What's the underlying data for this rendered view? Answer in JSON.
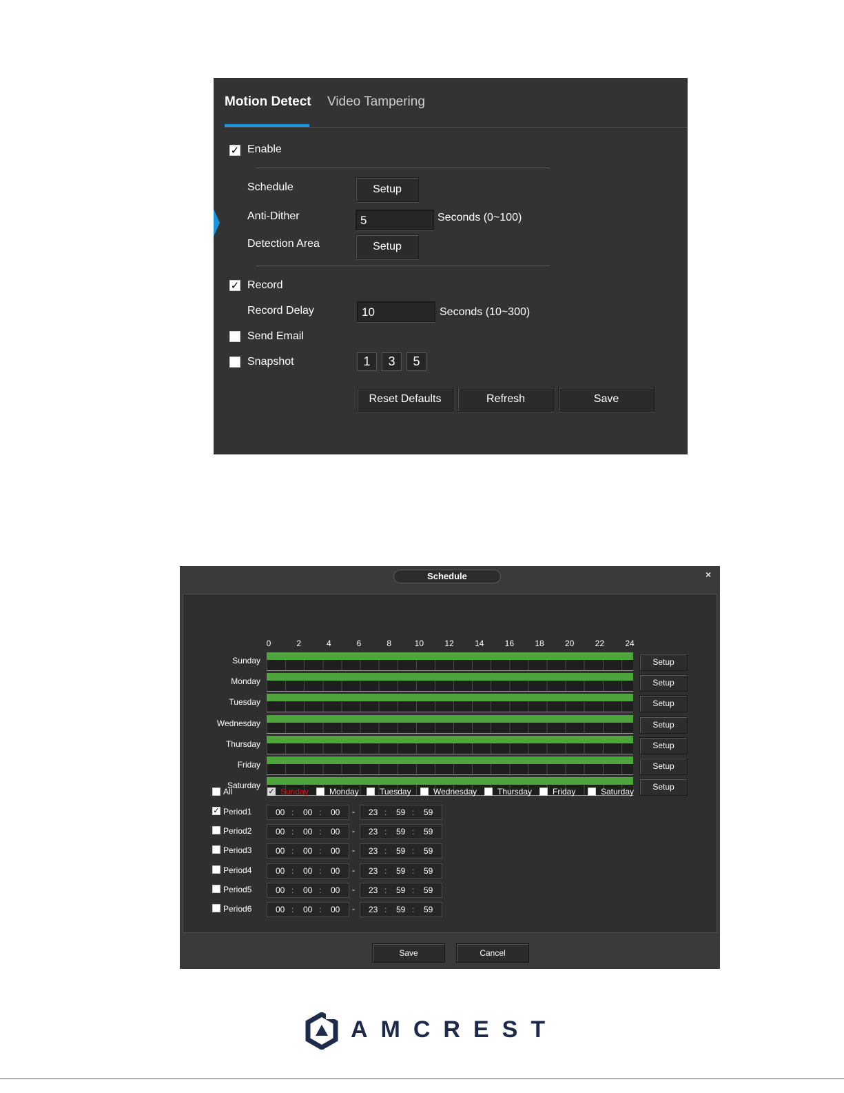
{
  "motion_panel": {
    "tabs": [
      "Motion Detect",
      "Video Tampering"
    ],
    "enable": {
      "label": "Enable",
      "checked": true
    },
    "schedule": {
      "label": "Schedule",
      "button": "Setup"
    },
    "anti_dither": {
      "label": "Anti-Dither",
      "value": "5",
      "unit": "Seconds (0~100)"
    },
    "detection_area": {
      "label": "Detection Area",
      "button": "Setup"
    },
    "record": {
      "label": "Record",
      "checked": true
    },
    "record_delay": {
      "label": "Record Delay",
      "value": "10",
      "unit": "Seconds (10~300)"
    },
    "send_email": {
      "label": "Send Email",
      "checked": false
    },
    "snapshot": {
      "label": "Snapshot",
      "checked": false,
      "channels": [
        "1",
        "3",
        "5"
      ]
    },
    "buttons": {
      "reset": "Reset Defaults",
      "refresh": "Refresh",
      "save": "Save"
    },
    "accent_color": "#1a93dd"
  },
  "schedule_dialog": {
    "title": "Schedule",
    "close": "×",
    "hours": [
      "0",
      "2",
      "4",
      "6",
      "8",
      "10",
      "12",
      "14",
      "16",
      "18",
      "20",
      "22",
      "24"
    ],
    "days": [
      {
        "name": "Sunday",
        "setup": "Setup"
      },
      {
        "name": "Monday",
        "setup": "Setup"
      },
      {
        "name": "Tuesday",
        "setup": "Setup"
      },
      {
        "name": "Wednesday",
        "setup": "Setup"
      },
      {
        "name": "Thursday",
        "setup": "Setup"
      },
      {
        "name": "Friday",
        "setup": "Setup"
      },
      {
        "name": "Saturday",
        "setup": "Setup"
      }
    ],
    "bar_color": "#4ea53c",
    "all_label": "All",
    "day_checks": [
      {
        "label": "Sunday",
        "checked": true,
        "highlight": true
      },
      {
        "label": "Monday",
        "checked": false
      },
      {
        "label": "Tuesday",
        "checked": false
      },
      {
        "label": "Wednesday",
        "checked": false
      },
      {
        "label": "Thursday",
        "checked": false
      },
      {
        "label": "Friday",
        "checked": false
      },
      {
        "label": "Saturday",
        "checked": false
      }
    ],
    "periods": [
      {
        "label": "Period1",
        "checked": true,
        "start": [
          "00",
          "00",
          "00"
        ],
        "end": [
          "23",
          "59",
          "59"
        ]
      },
      {
        "label": "Period2",
        "checked": false,
        "start": [
          "00",
          "00",
          "00"
        ],
        "end": [
          "23",
          "59",
          "59"
        ]
      },
      {
        "label": "Period3",
        "checked": false,
        "start": [
          "00",
          "00",
          "00"
        ],
        "end": [
          "23",
          "59",
          "59"
        ]
      },
      {
        "label": "Period4",
        "checked": false,
        "start": [
          "00",
          "00",
          "00"
        ],
        "end": [
          "23",
          "59",
          "59"
        ]
      },
      {
        "label": "Period5",
        "checked": false,
        "start": [
          "00",
          "00",
          "00"
        ],
        "end": [
          "23",
          "59",
          "59"
        ]
      },
      {
        "label": "Period6",
        "checked": false,
        "start": [
          "00",
          "00",
          "00"
        ],
        "end": [
          "23",
          "59",
          "59"
        ]
      }
    ],
    "buttons": {
      "save": "Save",
      "cancel": "Cancel"
    }
  },
  "footer": {
    "brand": "AMCREST",
    "logo_icon": "amcrest-hexagon-icon"
  }
}
